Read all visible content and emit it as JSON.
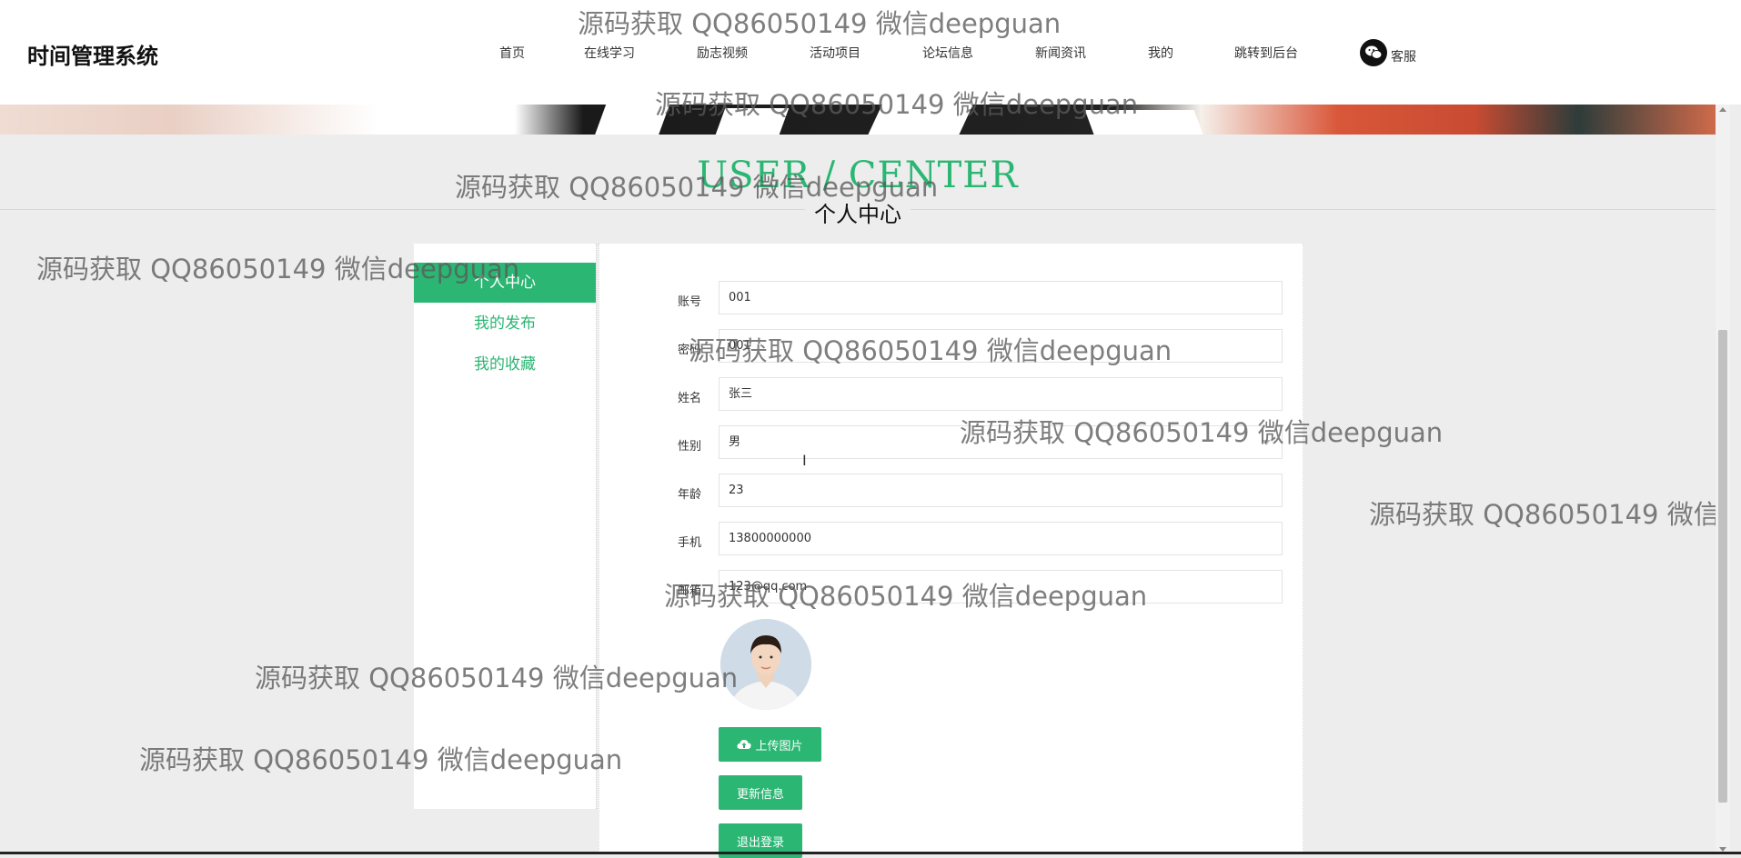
{
  "header": {
    "brand": "时间管理系统",
    "nav": [
      "首页",
      "在线学习",
      "励志视频",
      "活动项目",
      "论坛信息",
      "新闻资讯",
      "我的",
      "跳转到后台"
    ],
    "service_label": "客服"
  },
  "title": {
    "en": "USER / CENTER",
    "cn": "个人中心"
  },
  "sidebar": {
    "items": [
      {
        "label": "个人中心",
        "active": true
      },
      {
        "label": "我的发布",
        "active": false
      },
      {
        "label": "我的收藏",
        "active": false
      }
    ]
  },
  "form": {
    "fields": [
      {
        "label": "账号",
        "value": "001"
      },
      {
        "label": "密码",
        "value": "001"
      },
      {
        "label": "姓名",
        "value": "张三"
      },
      {
        "label": "性别",
        "value": "男"
      },
      {
        "label": "年龄",
        "value": "23"
      },
      {
        "label": "手机",
        "value": "13800000000"
      },
      {
        "label": "邮箱",
        "value": "123@qq.com"
      }
    ],
    "upload_label": "上传图片",
    "update_label": "更新信息",
    "logout_label": "退出登录"
  },
  "watermark": "源码获取 QQ86050149 微信deepguan",
  "colors": {
    "accent": "#2bb673",
    "background": "#ededed"
  }
}
